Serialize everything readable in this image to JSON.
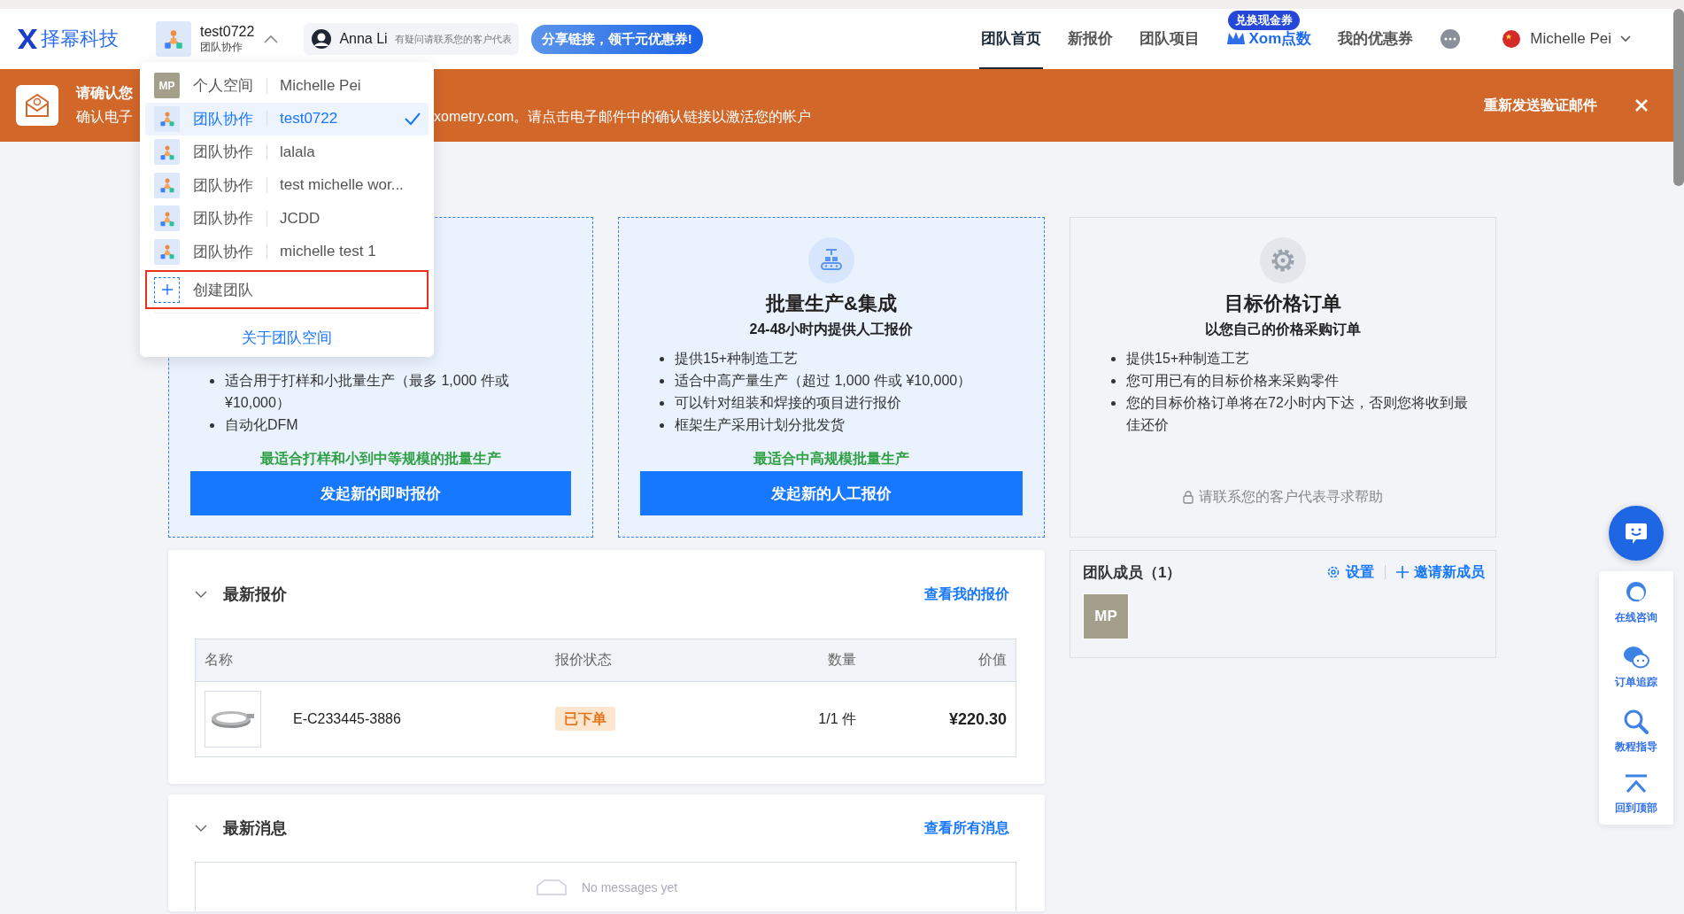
{
  "brand": {
    "name": "择幂科技"
  },
  "team_switcher": {
    "name": "test0722",
    "type": "团队协作",
    "expanded": true
  },
  "rep": {
    "name": "Anna Li",
    "hint": "有疑问请联系您的客户代表"
  },
  "share_button": "分享链接，领千元优惠券!",
  "nav": [
    {
      "label": "团队首页",
      "selected": true,
      "kind": "text"
    },
    {
      "label": "新报价",
      "selected": false,
      "kind": "text"
    },
    {
      "label": "团队项目",
      "selected": false,
      "kind": "text"
    },
    {
      "label": "Xom点数",
      "selected": false,
      "kind": "points",
      "badge": "兑换现金券"
    },
    {
      "label": "我的优惠券",
      "selected": false,
      "kind": "text"
    }
  ],
  "user": {
    "name": "Michelle Pei"
  },
  "banner": {
    "title": "请确认您",
    "text_left": "确认电子",
    "text_right": "xometry.com。请点击电子邮件中的确认链接以激活您的帐户",
    "action": "重新发送验证邮件"
  },
  "dropdown": {
    "items": [
      {
        "kind": "personal",
        "avatar": "MP",
        "type": "个人空间",
        "name": "Michelle Pei",
        "selected": false
      },
      {
        "kind": "team",
        "type": "团队协作",
        "name": "test0722",
        "selected": true
      },
      {
        "kind": "team",
        "type": "团队协作",
        "name": "lalala",
        "selected": false
      },
      {
        "kind": "team",
        "type": "团队协作",
        "name": "test michelle wor...",
        "selected": false
      },
      {
        "kind": "team",
        "type": "团队协作",
        "name": "JCDD",
        "selected": false
      },
      {
        "kind": "team",
        "type": "团队协作",
        "name": "michelle test 1",
        "selected": false
      }
    ],
    "create": "创建团队",
    "about": "关于团队空间"
  },
  "cards": [
    {
      "kind": "instant",
      "bullets": [
        "适合用于打样和小批量生产（最多 1,000 件或 ¥10,000）",
        "自动化DFM"
      ],
      "best_for": "最适合打样和小到中等规模的批量生产",
      "button": "发起新的即时报价"
    },
    {
      "kind": "manual",
      "title": "批量生产&集成",
      "subtitle": "24-48小时内提供人工报价",
      "bullets": [
        "提供15+种制造工艺",
        "适合中高产量生产（超过 1,000 件或 ¥10,000）",
        "可以针对组装和焊接的项目进行报价",
        "框架生产采用计划分批发货"
      ],
      "best_for": "最适合中高规模批量生产",
      "button": "发起新的人工报价"
    },
    {
      "kind": "target",
      "title": "目标价格订单",
      "subtitle": "以您自己的价格采购订单",
      "bullets": [
        "提供15+种制造工艺",
        "您可用已有的目标价格来采购零件",
        "您的目标价格订单将在72小时内下达，否则您将收到最佳还价"
      ],
      "locked_note": "请联系您的客户代表寻求帮助"
    }
  ],
  "quotes": {
    "title": "最新报价",
    "link": "查看我的报价",
    "columns": [
      "名称",
      "报价状态",
      "数量",
      "价值"
    ],
    "rows": [
      {
        "name": "E-C233445-3886",
        "status": "已下单",
        "quantity": "1/1 件",
        "value": "¥220.30"
      }
    ]
  },
  "messages": {
    "title": "最新消息",
    "link": "查看所有消息",
    "empty": "No messages yet"
  },
  "team_members": {
    "title": "团队成员（1）",
    "settings": "设置",
    "invite": "邀请新成员",
    "members": [
      "MP"
    ]
  },
  "side_tools": [
    {
      "kind": "agent",
      "label": "在线咨询"
    },
    {
      "kind": "chat",
      "label": "订单追踪"
    },
    {
      "kind": "search",
      "label": "教程指导"
    },
    {
      "kind": "top",
      "label": "回到顶部"
    }
  ]
}
